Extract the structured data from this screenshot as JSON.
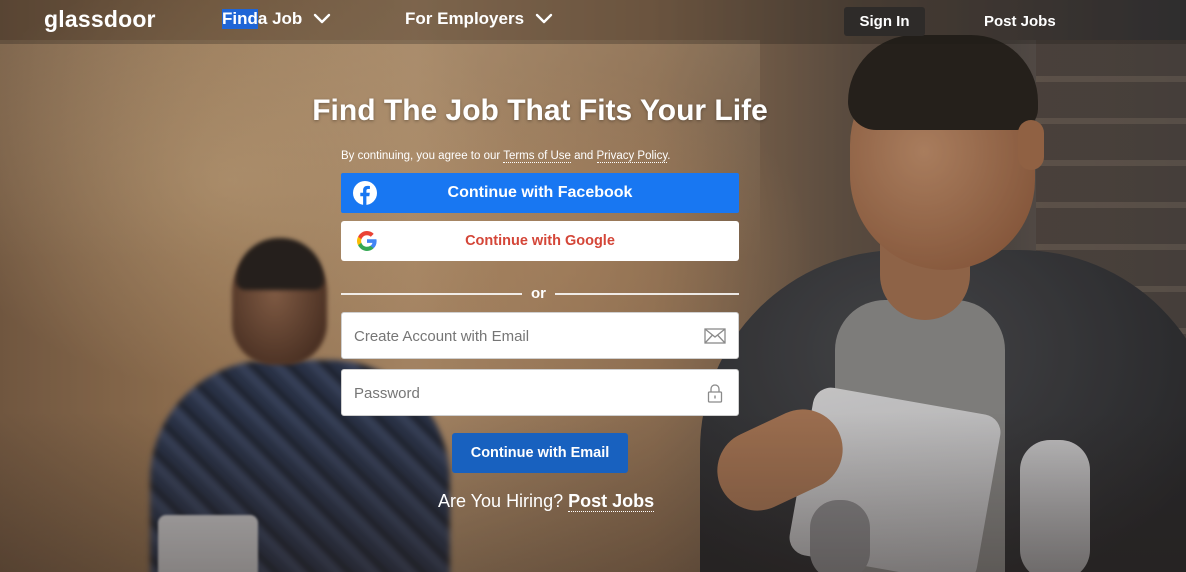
{
  "nav": {
    "logo": "glassdoor",
    "find_prefix": "Find",
    "find_suffix": " a Job",
    "employers": "For Employers",
    "sign_in": "Sign In",
    "post_jobs": "Post Jobs"
  },
  "main": {
    "headline": "Find The Job That Fits Your Life",
    "terms_prefix": "By continuing, you agree to our ",
    "terms_link": "Terms of Use",
    "terms_and": " and ",
    "privacy_link": "Privacy Policy",
    "terms_suffix": ".",
    "facebook_button": "Continue with Facebook",
    "google_button": "Continue with Google",
    "or": "or",
    "email_placeholder": "Create Account with Email",
    "password_placeholder": "Password",
    "email_button": "Continue with Email",
    "hiring_prefix": "Are You Hiring? ",
    "hiring_link": "Post Jobs"
  },
  "icons": {
    "facebook": "facebook-icon",
    "google": "google-icon",
    "email": "envelope-icon",
    "password": "lock-icon",
    "dropdown": "chevron-down-icon"
  },
  "colors": {
    "facebook_blue": "#1877f2",
    "google_red": "#d44638",
    "email_button_blue": "#1861bf",
    "sign_in_bg": "#2e2b29",
    "selection_highlight": "#1f65d6"
  }
}
